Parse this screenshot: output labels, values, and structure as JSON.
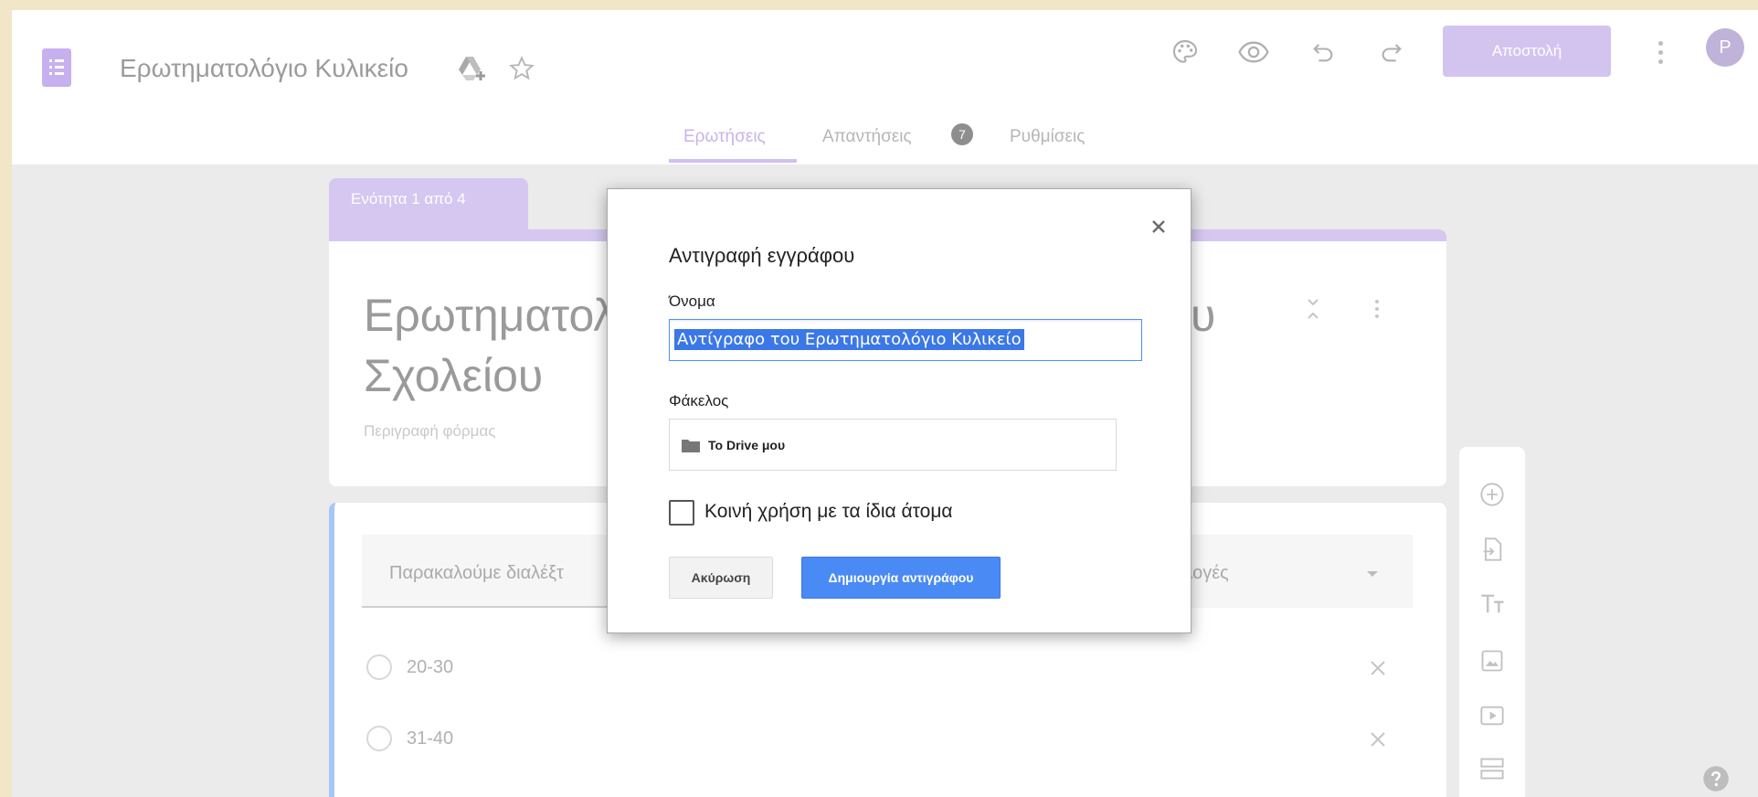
{
  "header": {
    "doc_title": "Ερωτηματολόγιο Κυλικείο",
    "send_label": "Αποστολή",
    "avatar_initial": "P",
    "icons": [
      "forms-doc-icon",
      "drive-add-icon",
      "star-icon",
      "palette-icon",
      "preview-eye-icon",
      "undo-icon",
      "redo-icon",
      "more-vert-icon"
    ]
  },
  "tabs": [
    {
      "label": "Ερωτήσεις",
      "active": true
    },
    {
      "label": "Απαντήσεις",
      "badge": "7"
    },
    {
      "label": "Ρυθμίσεις"
    }
  ],
  "form": {
    "section_label": "Ενότητα 1 από 4",
    "title_line1": "Ερωτηματολ",
    "title_tail": "υ",
    "title_line2": "Σχολείου",
    "description": "Περιγραφή φόρμας"
  },
  "question": {
    "placeholder": "Παρακαλούμε διαλέξτ",
    "type_label": "ιλογές",
    "options": [
      "20-30",
      "31-40"
    ]
  },
  "dialog": {
    "title": "Αντιγραφή εγγράφου",
    "name_label": "Όνομα",
    "name_value": "Αντίγραφο του Ερωτηματολόγιο Κυλικείο",
    "folder_label": "Φάκελος",
    "folder_value": "To Drive μου",
    "share_label": "Κοινή χρήση με τα ίδια άτομα",
    "share_checked": false,
    "cancel_label": "Ακύρωση",
    "create_label": "Δημιουργία αντιγράφου"
  },
  "colors": {
    "accent": "#d3c4ef",
    "primary_button": "#4a8af4",
    "question_border": "#a5c6f6",
    "outer_frame": "#f1e6c8"
  }
}
